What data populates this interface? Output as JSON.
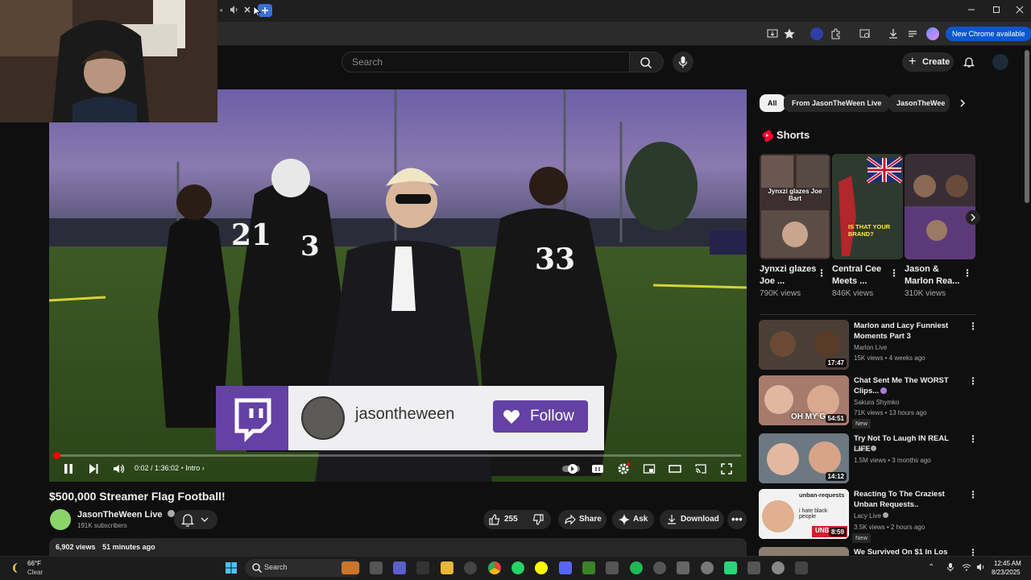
{
  "browser": {
    "new_chrome_label": "New Chrome available"
  },
  "youtube": {
    "search_placeholder": "Search",
    "create_label": "Create"
  },
  "video": {
    "twitch_overlay": {
      "username": "jasontheween",
      "follow_label": "Follow"
    },
    "timecode": "0:02 / 1:36:02",
    "chapter": "Intro",
    "progress_fraction": 0.0003,
    "title": "$500,000 Streamer Flag Football!",
    "channel": {
      "name": "JasonTheWeen Live",
      "subscribers": "191K subscribers"
    },
    "actions": {
      "likes": "255",
      "share": "Share",
      "ask": "Ask",
      "download": "Download"
    },
    "description": {
      "views": "6,902 views",
      "time": "51 minutes ago"
    }
  },
  "sidebar": {
    "chips": [
      "All",
      "From JasonTheWeen Live",
      "JasonTheWee"
    ],
    "shorts_heading": "Shorts",
    "shorts": [
      {
        "title": "Jynxzi glazes Joe ...",
        "views": "790K views",
        "overlay": "Jynxzi glazes Joe Bart"
      },
      {
        "title": "Central Cee Meets ...",
        "views": "846K views",
        "overlay": "IS THAT YOUR BRAND?"
      },
      {
        "title": "Jason & Marlon Rea...",
        "views": "310K views",
        "overlay": ""
      }
    ],
    "videos": [
      {
        "title": "Marlon and Lacy Funniest Moments Part 3",
        "channel": "Marlon Live",
        "meta": "15K views • 4 weeks ago",
        "duration": "17:47",
        "new": ""
      },
      {
        "title": "Chat Sent Me The WORST Clips...",
        "channel": "Sakura Shymko",
        "meta": "71K views • 13 hours ago",
        "duration": "54:51",
        "new": "New",
        "overlay": "OH MY G"
      },
      {
        "title": "Try Not To Laugh IN REAL LIFE",
        "channel": "FaZe",
        "meta": "1.5M views • 3 months ago",
        "duration": "14:12",
        "new": ""
      },
      {
        "title": "Reacting To The Craziest Unban Requests..",
        "channel": "Lacy Live",
        "meta": "3.5K views • 2 hours ago",
        "duration": "8:59",
        "new": "New",
        "overlay": "unban-requests",
        "overlay2": "i hate black people",
        "overlay3": "UNBAN"
      },
      {
        "title": "We Survived On $1 In Los",
        "channel": "",
        "meta": "",
        "duration": "",
        "new": ""
      }
    ]
  },
  "taskbar": {
    "weather_temp": "66°F",
    "weather_desc": "Clear",
    "search_label": "Search",
    "time": "12:45 AM",
    "date": "8/23/2025"
  },
  "colors": {
    "youtube_red": "#ff0000",
    "twitch_purple": "#6441a5",
    "chrome_blue": "#0b57d0"
  }
}
